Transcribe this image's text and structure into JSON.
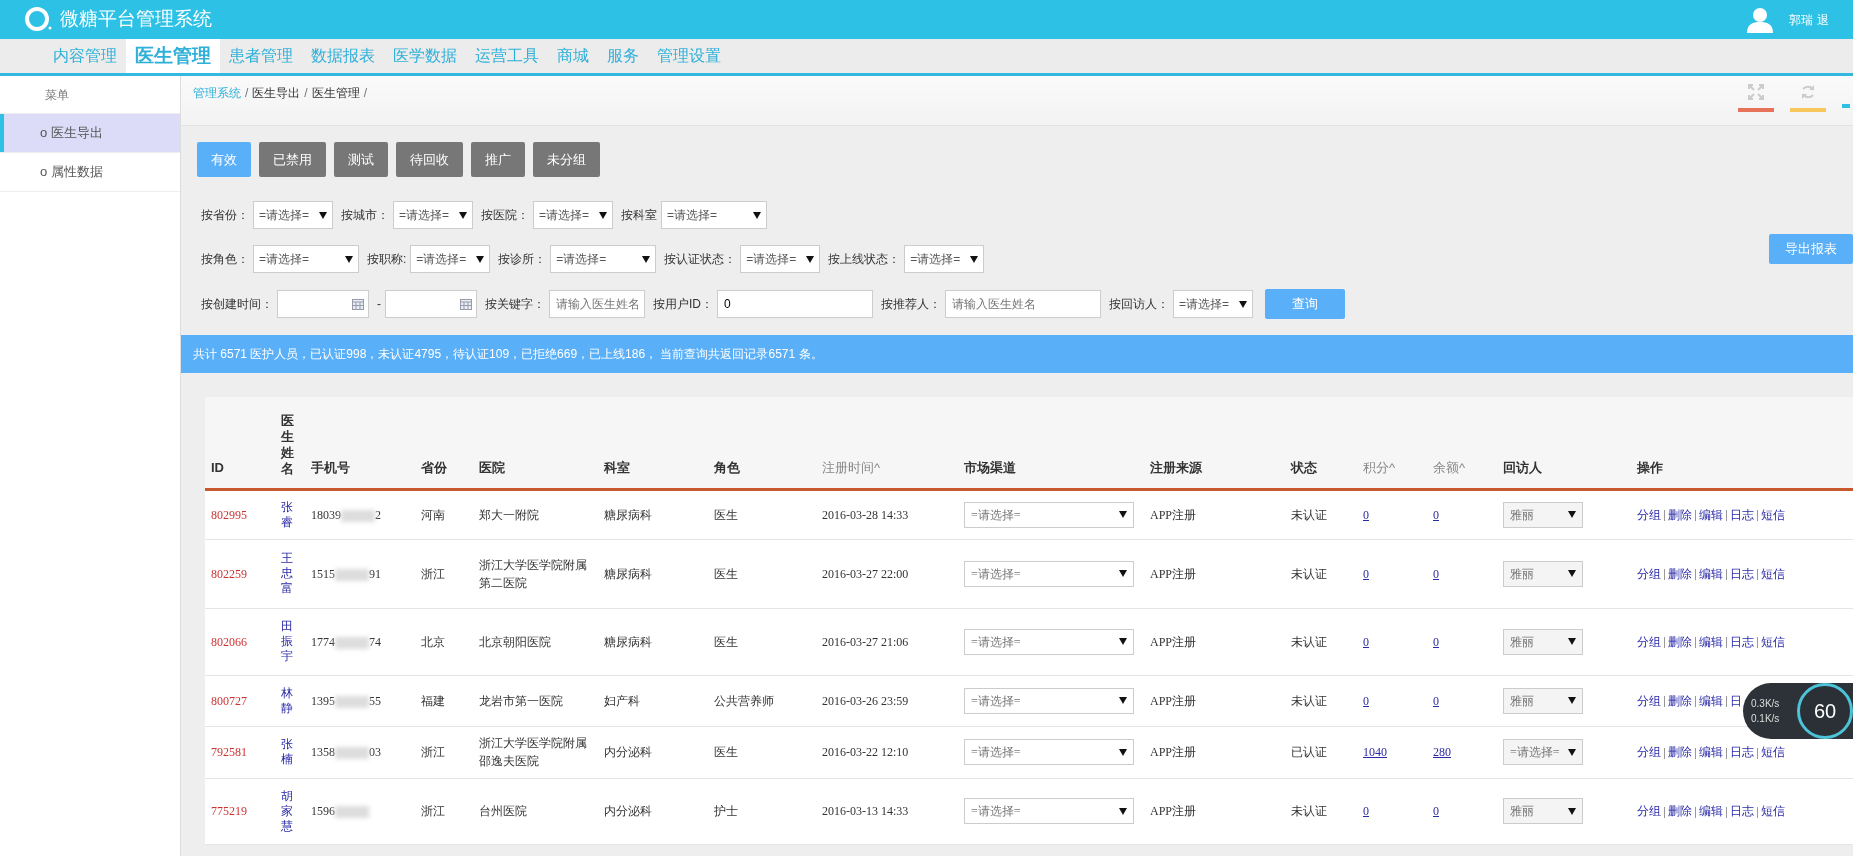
{
  "header": {
    "title": "微糖平台管理系统",
    "user": "郭瑞",
    "logout": "退"
  },
  "nav": [
    {
      "label": "内容管理",
      "selected": false
    },
    {
      "label": "医生管理",
      "selected": true
    },
    {
      "label": "患者管理",
      "selected": false
    },
    {
      "label": "数据报表",
      "selected": false
    },
    {
      "label": "医学数据",
      "selected": false
    },
    {
      "label": "运营工具",
      "selected": false
    },
    {
      "label": "商城",
      "selected": false
    },
    {
      "label": "服务",
      "selected": false
    },
    {
      "label": "管理设置",
      "selected": false
    }
  ],
  "sidebar": {
    "heading": "菜单",
    "items": [
      {
        "label": "o 医生导出",
        "selected": true
      },
      {
        "label": "o 属性数据",
        "selected": false
      }
    ]
  },
  "breadcrumb": {
    "separator": "/",
    "items": [
      {
        "label": "管理系统",
        "kind": "link"
      },
      {
        "label": "医生导出",
        "kind": "text"
      },
      {
        "label": "医生管理",
        "kind": "text"
      }
    ]
  },
  "status_tabs": [
    {
      "label": "有效",
      "selected": true
    },
    {
      "label": "已禁用",
      "selected": false
    },
    {
      "label": "测试",
      "selected": false
    },
    {
      "label": "待回收",
      "selected": false
    },
    {
      "label": "推广",
      "selected": false
    },
    {
      "label": "未分组",
      "selected": false
    }
  ],
  "filters": [
    [
      {
        "kind": "select",
        "label": "按省份：",
        "value": "=请选择="
      },
      {
        "kind": "select",
        "label": "按城市：",
        "value": "=请选择="
      },
      {
        "kind": "select",
        "label": "按医院：",
        "value": "=请选择="
      },
      {
        "kind": "select",
        "label": "按科室",
        "value": "=请选择=",
        "wide": true
      }
    ],
    [
      {
        "kind": "select",
        "label": "按角色：",
        "value": "=请选择=",
        "wide": true
      },
      {
        "kind": "select",
        "label": "按职称:",
        "value": "=请选择="
      },
      {
        "kind": "select",
        "label": "按诊所：",
        "value": "=请选择=",
        "wide": true
      },
      {
        "kind": "select",
        "label": "按认证状态：",
        "value": "=请选择="
      },
      {
        "kind": "select",
        "label": "按上线状态：",
        "value": "=请选择="
      }
    ],
    [
      {
        "kind": "date",
        "label": "按创建时间："
      },
      {
        "kind": "date",
        "label": "-"
      },
      {
        "kind": "text",
        "label": "按关键字：",
        "placeholder": "请输入医生姓名"
      },
      {
        "kind": "text",
        "label": "按用户ID：",
        "value": "0",
        "wide": true
      },
      {
        "kind": "text",
        "label": "按推荐人：",
        "placeholder": "请输入医生姓名",
        "wide": true
      },
      {
        "kind": "select",
        "label": "按回访人：",
        "value": "=请选择="
      }
    ]
  ],
  "query_button": "查询",
  "export_button": "导出报表",
  "summary": "共计 6571 医护人员，已认证998，未认证4795，待认证109，已拒绝669，已上线186，  当前查询共返回记录6571 条。",
  "table": {
    "columns": [
      {
        "label": "ID",
        "sortable": false
      },
      {
        "label": "医生姓名",
        "sortable": false
      },
      {
        "label": "手机号",
        "sortable": false
      },
      {
        "label": "省份",
        "sortable": false
      },
      {
        "label": "医院",
        "sortable": false
      },
      {
        "label": "科室",
        "sortable": false
      },
      {
        "label": "角色",
        "sortable": false
      },
      {
        "label": "注册时间^",
        "sortable": true
      },
      {
        "label": "市场渠道",
        "sortable": false
      },
      {
        "label": "注册来源",
        "sortable": false
      },
      {
        "label": "状态",
        "sortable": false
      },
      {
        "label": "积分^",
        "sortable": true
      },
      {
        "label": "余额^",
        "sortable": true
      },
      {
        "label": "回访人",
        "sortable": false
      },
      {
        "label": "操作",
        "sortable": false
      }
    ],
    "rows": [
      {
        "id": "802995",
        "name": "张睿",
        "phone_start": "18039",
        "phone_end": "2",
        "province": "河南",
        "hospital": "郑大一附院",
        "department": "糖尿病科",
        "role": "医生",
        "registered": "2016-03-28 14:33",
        "channel": "=请选择=",
        "source": "APP注册",
        "status": "未认证",
        "points": "0",
        "balance": "0",
        "visitor": "雅丽",
        "actions": [
          "分组",
          "删除",
          "编辑",
          "日志",
          "短信"
        ]
      },
      {
        "id": "802259",
        "name": "王忠富",
        "phone_start": "1515",
        "phone_end": "91",
        "province": "浙江",
        "hospital": "浙江大学医学院附属第二医院",
        "department": "糖尿病科",
        "role": "医生",
        "registered": "2016-03-27 22:00",
        "channel": "=请选择=",
        "source": "APP注册",
        "status": "未认证",
        "points": "0",
        "balance": "0",
        "visitor": "雅丽",
        "actions": [
          "分组",
          "删除",
          "编辑",
          "日志",
          "短信"
        ]
      },
      {
        "id": "802066",
        "name": "田振宇",
        "phone_start": "1774",
        "phone_end": "74",
        "province": "北京",
        "hospital": "北京朝阳医院",
        "department": "糖尿病科",
        "role": "医生",
        "registered": "2016-03-27 21:06",
        "channel": "=请选择=",
        "source": "APP注册",
        "status": "未认证",
        "points": "0",
        "balance": "0",
        "visitor": "雅丽",
        "actions": [
          "分组",
          "删除",
          "编辑",
          "日志",
          "短信"
        ]
      },
      {
        "id": "800727",
        "name": "林静",
        "phone_start": "1395",
        "phone_end": "55",
        "province": "福建",
        "hospital": "龙岩市第一医院",
        "department": "妇产科",
        "role": "公共营养师",
        "registered": "2016-03-26 23:59",
        "channel": "=请选择=",
        "source": "APP注册",
        "status": "未认证",
        "points": "0",
        "balance": "0",
        "visitor": "雅丽",
        "actions": [
          "分组",
          "删除",
          "编辑",
          "日"
        ]
      },
      {
        "id": "792581",
        "name": "张楠",
        "phone_start": "1358",
        "phone_end": "03",
        "province": "浙江",
        "hospital": "浙江大学医学院附属邵逸夫医院",
        "department": "内分泌科",
        "role": "医生",
        "registered": "2016-03-22 12:10",
        "channel": "=请选择=",
        "source": "APP注册",
        "status": "已认证",
        "points": "1040",
        "balance": "280",
        "visitor": "=请选择=",
        "actions": [
          "分组",
          "删除",
          "编辑",
          "日志",
          "短信"
        ]
      },
      {
        "id": "775219",
        "name": "胡家慧",
        "phone_start": "1596",
        "phone_end": "",
        "province": "浙江",
        "hospital": "台州医院",
        "department": "内分泌科",
        "role": "护士",
        "registered": "2016-03-13 14:33",
        "channel": "=请选择=",
        "source": "APP注册",
        "status": "未认证",
        "points": "0",
        "balance": "0",
        "visitor": "雅丽",
        "actions": [
          "分组",
          "删除",
          "编辑",
          "日志",
          "短信"
        ]
      }
    ]
  },
  "speed_widget": {
    "upload": "0.3K/s",
    "download": "0.1K/s",
    "percent": "60"
  }
}
